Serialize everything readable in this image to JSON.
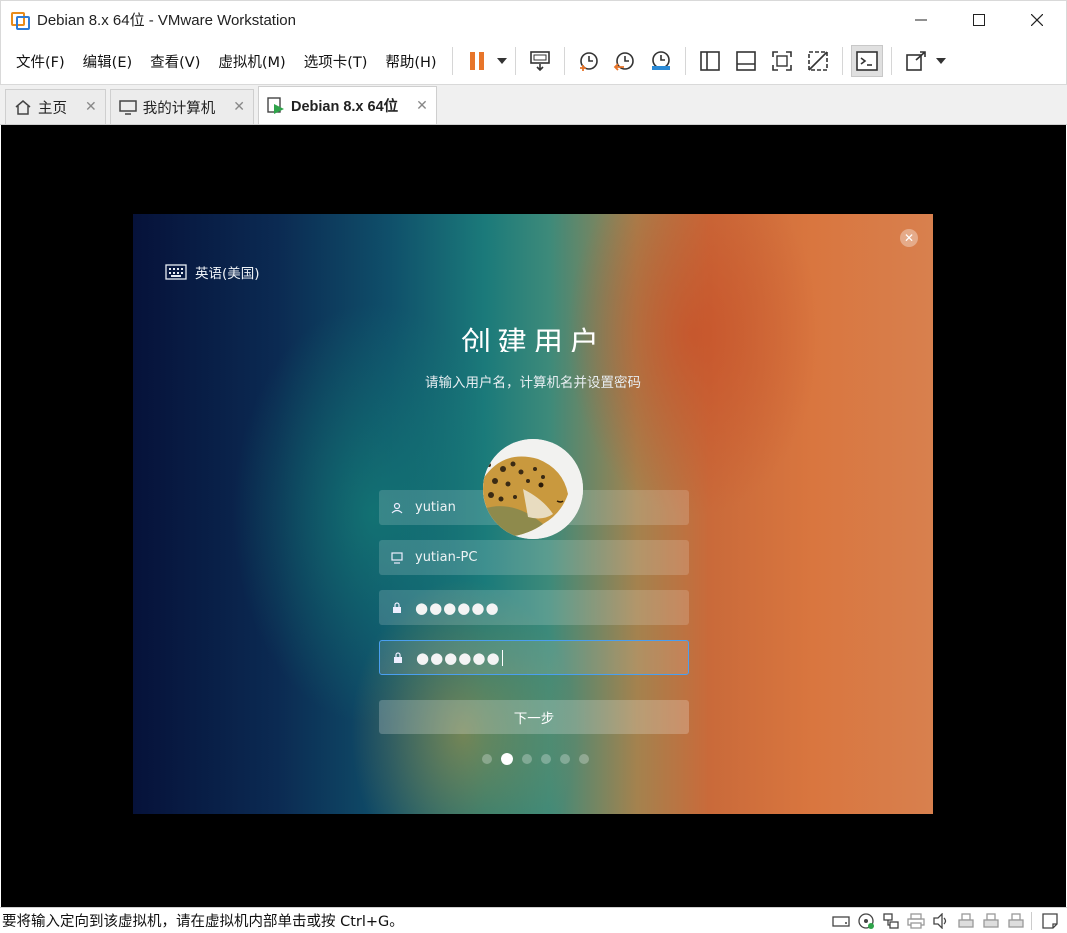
{
  "window": {
    "title": "Debian 8.x 64位 - VMware Workstation"
  },
  "menu": {
    "items": [
      "文件(F)",
      "编辑(E)",
      "查看(V)",
      "虚拟机(M)",
      "选项卡(T)",
      "帮助(H)"
    ]
  },
  "toolbar": {
    "icons": [
      "pause-icon",
      "send-ctrl-alt-del-icon",
      "snapshot-icon",
      "revert-snapshot-icon",
      "snapshot-manager-icon",
      "library-icon",
      "thumbnail-icon",
      "fullscreen-icon",
      "unity-icon",
      "console-icon",
      "stretch-icon"
    ],
    "pause_color": "#e8752a"
  },
  "tabs": [
    {
      "label": "主页",
      "icon": "home-icon"
    },
    {
      "label": "我的计算机",
      "icon": "monitor-icon"
    },
    {
      "label": "Debian 8.x 64位",
      "icon": "vm-running-icon",
      "active": true
    }
  ],
  "installer": {
    "language": "英语(美国)",
    "title": "创建用户",
    "subtitle": "请输入用户名，计算机名并设置密码",
    "fields": {
      "username": "yutian",
      "hostname": "yutian-PC",
      "password": "●●●●●●",
      "confirm_password": "●●●●●●"
    },
    "next_label": "下一步",
    "progress": {
      "total_steps": 6,
      "current_step": 2
    }
  },
  "status": {
    "text": "要将输入定向到该虚拟机，请在虚拟机内部单击或按 Ctrl+G。",
    "icons": [
      "hard-disk-icon",
      "cd-icon",
      "network-icon",
      "printer-icon",
      "sound-icon",
      "usb-icon",
      "usb-icon",
      "usb-icon",
      "message-icon"
    ]
  }
}
